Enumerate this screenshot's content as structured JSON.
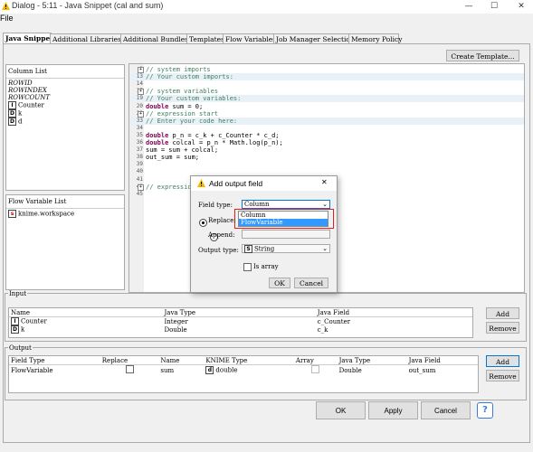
{
  "window": {
    "title": "Dialog - 5:11 - Java Snippet (cal and sum)",
    "minimize": "—",
    "maximize": "☐",
    "close": "✕"
  },
  "menu": {
    "file": "File"
  },
  "tabs": [
    "Java Snippet",
    "Additional Libraries",
    "Additional Bundles",
    "Templates",
    "Flow Variables",
    "Job Manager Selection",
    "Memory Policy"
  ],
  "create_template": "Create Template...",
  "column_list": {
    "title": "Column List",
    "items": [
      {
        "label": "ROWID",
        "icon": "",
        "italic": true
      },
      {
        "label": "ROWINDEX",
        "icon": "",
        "italic": true
      },
      {
        "label": "ROWCOUNT",
        "icon": "",
        "italic": true
      },
      {
        "label": "Counter",
        "icon": "I",
        "italic": false
      },
      {
        "label": "k",
        "icon": "D",
        "italic": false
      },
      {
        "label": "d",
        "icon": "D",
        "italic": false
      }
    ]
  },
  "flow_variable_list": {
    "title": "Flow Variable List",
    "items": [
      {
        "label": "knime.workspace",
        "icon": "s"
      }
    ]
  },
  "code": [
    {
      "n": "1",
      "t": "// system imports",
      "c": "cmt",
      "g": false,
      "fold": true
    },
    {
      "n": "13",
      "t": "// Your custom imports:",
      "c": "cmt",
      "g": true
    },
    {
      "n": "14",
      "t": "",
      "c": "",
      "g": false
    },
    {
      "n": "15",
      "t": "// system variables",
      "c": "cmt",
      "g": false,
      "fold": true
    },
    {
      "n": "19",
      "t": "// Your custom variables:",
      "c": "cmt",
      "g": true
    },
    {
      "n": "20",
      "t": "double sum = 0;",
      "c": "",
      "g": false
    },
    {
      "n": "21",
      "t": "// expression start",
      "c": "cmt",
      "g": false,
      "fold": true
    },
    {
      "n": "33",
      "t": "// Enter your code here:",
      "c": "cmt",
      "g": true
    },
    {
      "n": "34",
      "t": "",
      "c": "",
      "g": false
    },
    {
      "n": "35",
      "t": "double p_n = c_k + c_Counter * c_d;",
      "c": "",
      "g": false
    },
    {
      "n": "36",
      "t": "double colcal = p_n * Math.log(p_n);",
      "c": "",
      "g": false
    },
    {
      "n": "37",
      "t": "sum = sum + colcal;",
      "c": "",
      "g": false
    },
    {
      "n": "38",
      "t": "out_sum = sum;",
      "c": "",
      "g": false
    },
    {
      "n": "39",
      "t": "",
      "c": "",
      "g": false
    },
    {
      "n": "40",
      "t": "",
      "c": "",
      "g": false
    },
    {
      "n": "41",
      "t": "",
      "c": "",
      "g": false
    },
    {
      "n": "42",
      "t": "// expression end",
      "c": "cmt",
      "g": false,
      "fold": true
    },
    {
      "n": "45",
      "t": "",
      "c": "",
      "g": false
    }
  ],
  "input": {
    "title": "Input",
    "headers": [
      "Name",
      "Java Type",
      "Java Field"
    ],
    "rows": [
      {
        "name": "Counter",
        "icon": "I",
        "java_type": "Integer",
        "field": "c_Counter"
      },
      {
        "name": "k",
        "icon": "D",
        "java_type": "Double",
        "field": "c_k"
      }
    ],
    "add": "Add",
    "remove": "Remove"
  },
  "output": {
    "title": "Output",
    "headers": [
      "Field Type",
      "Replace",
      "Name",
      "KNIME Type",
      "Array",
      "Java Type",
      "Java Field"
    ],
    "rows": [
      {
        "field_type": "FlowVariable",
        "name": "sum",
        "knime_type": "double",
        "icon": "d",
        "java_type": "Double",
        "field": "out_sum"
      }
    ],
    "add": "Add",
    "remove": "Remove"
  },
  "footer": {
    "ok": "OK",
    "apply": "Apply",
    "cancel": "Cancel",
    "help": "?"
  },
  "dialog": {
    "title": "Add output field",
    "close": "✕",
    "field_type_label": "Field type:",
    "field_type_value": "Column",
    "options": [
      "Column",
      "FlowVariable"
    ],
    "replace_label": "Replace:",
    "append_label": "Append:",
    "output_type_label": "Output type:",
    "output_type_icon": "S",
    "output_type_value": "String",
    "is_array_label": "Is array",
    "ok": "OK",
    "cancel": "Cancel"
  },
  "colors": {
    "highlight": "#3399ff",
    "annotation_red": "#e02020",
    "warning": "#f5b800"
  }
}
